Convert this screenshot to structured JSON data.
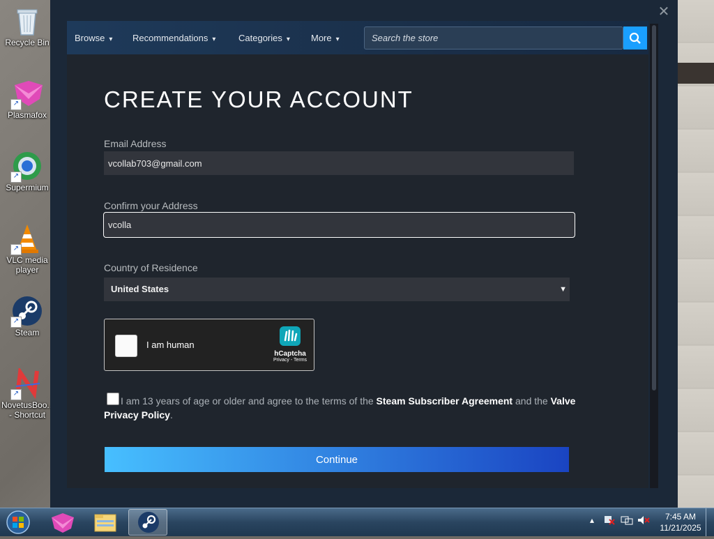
{
  "desktop": {
    "icons": [
      {
        "label": "Recycle Bin",
        "icon": "recycle-bin-icon"
      },
      {
        "label": "Plasmafox",
        "icon": "plasmafox-icon"
      },
      {
        "label": "Supermium",
        "icon": "supermium-icon"
      },
      {
        "label": "VLC media player",
        "icon": "vlc-icon"
      },
      {
        "label": "Steam",
        "icon": "steam-icon"
      },
      {
        "label": "NovetusBoo... - Shortcut",
        "icon": "novetus-icon"
      }
    ]
  },
  "window": {
    "close_glyph": "✕"
  },
  "nav": {
    "items": [
      {
        "label": "Browse"
      },
      {
        "label": "Recommendations"
      },
      {
        "label": "Categories"
      },
      {
        "label": "More"
      }
    ],
    "search_placeholder": "Search the store"
  },
  "form": {
    "title": "CREATE YOUR ACCOUNT",
    "email_label": "Email Address",
    "email_value": "vcollab703@gmail.com",
    "confirm_label": "Confirm your Address",
    "confirm_value": "vcolla",
    "country_label": "Country of Residence",
    "country_value": "United States",
    "captcha": {
      "label": "I am human",
      "brand": "hCaptcha",
      "links": "Privacy - Terms"
    },
    "agree": {
      "pre": "I am 13 years of age or older and agree to the terms of the ",
      "ssa": "Steam Subscriber Agreement",
      "mid": " and the ",
      "privacy": "Valve Privacy Policy",
      "post": "."
    },
    "continue_label": "Continue"
  },
  "taskbar": {
    "time": "7:45 AM",
    "date": "11/21/2025"
  },
  "colors": {
    "window_bg": "#1b2838",
    "content_bg": "#1f252d",
    "accent": "#1a9fff",
    "button_gradient_start": "#47bfff",
    "button_gradient_end": "#1a44c2"
  }
}
